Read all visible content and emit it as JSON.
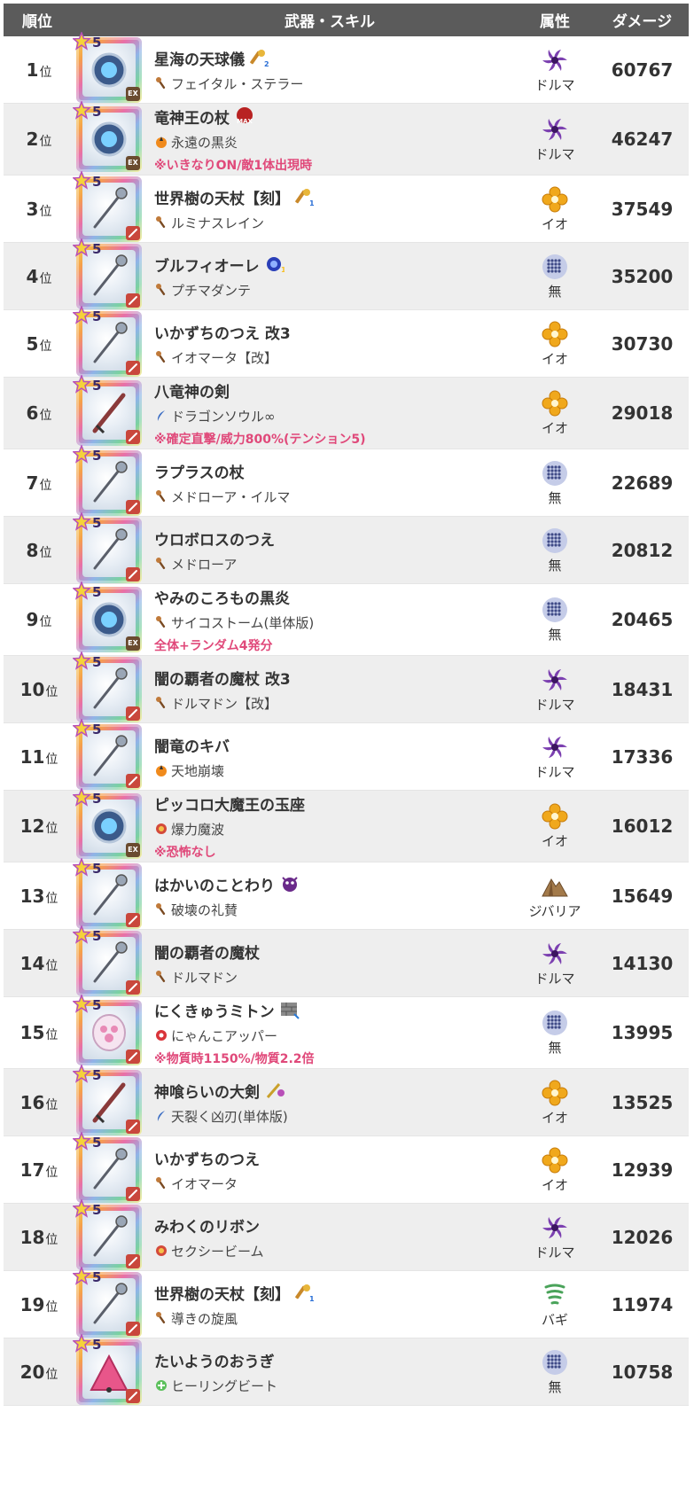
{
  "header": {
    "rank": "順位",
    "weapon_skill": "武器・スキル",
    "element": "属性",
    "damage": "ダメージ"
  },
  "rank_suffix": "位",
  "colors": {
    "header_bg": "#5b5b5b",
    "alt_row_bg": "#eeeeee",
    "note_pink": "#e0497a",
    "dolma_purple": "#7b3fb0",
    "io_orange": "#f0a81c"
  },
  "rows": [
    {
      "rank": "1",
      "weapon": "星海の天球儀",
      "badge": "weapon-level-2-icon",
      "skill": "フェイタル・ステラー",
      "skill_icon": "staff-skill-icon",
      "note": "",
      "element": "ドルマ",
      "damage": "60767",
      "corner": "EX"
    },
    {
      "rank": "2",
      "weapon": "竜神王の杖",
      "badge": "max-badge-icon",
      "skill": "永遠の黒炎",
      "skill_icon": "fire-skill-icon",
      "note": "※いきなりON/敵1体出現時",
      "element": "ドルマ",
      "damage": "46247",
      "corner": "EX"
    },
    {
      "rank": "3",
      "weapon": "世界樹の天杖【刻】",
      "badge": "weapon-level-1-icon",
      "skill": "ルミナスレイン",
      "skill_icon": "staff-skill-icon",
      "note": "",
      "element": "イオ",
      "damage": "37549",
      "corner": "staff"
    },
    {
      "rank": "4",
      "weapon": "ブルフィオーレ",
      "badge": "swirl-level-1-icon",
      "skill": "プチマダンテ",
      "skill_icon": "staff-skill-icon",
      "note": "",
      "element": "無",
      "damage": "35200",
      "corner": "whip"
    },
    {
      "rank": "5",
      "weapon": "いかずちのつえ 改3",
      "badge": "",
      "skill": "イオマータ【改】",
      "skill_icon": "staff-skill-icon",
      "note": "",
      "element": "イオ",
      "damage": "30730",
      "corner": "staff"
    },
    {
      "rank": "6",
      "weapon": "八竜神の剣",
      "badge": "",
      "skill": "ドラゴンソウル∞",
      "skill_icon": "slash-skill-icon",
      "note": "※確定直撃/威力800%(テンション5)",
      "element": "イオ",
      "damage": "29018",
      "corner": "sword"
    },
    {
      "rank": "7",
      "weapon": "ラプラスの杖",
      "badge": "",
      "skill": "メドローア・イルマ",
      "skill_icon": "staff-skill-icon",
      "note": "",
      "element": "無",
      "damage": "22689",
      "corner": "staff"
    },
    {
      "rank": "8",
      "weapon": "ウロボロスのつえ",
      "badge": "",
      "skill": "メドローア",
      "skill_icon": "staff-skill-icon",
      "note": "",
      "element": "無",
      "damage": "20812",
      "corner": "staff"
    },
    {
      "rank": "9",
      "weapon": "やみのころもの黒炎",
      "badge": "",
      "skill": "サイコストーム(単体版)",
      "skill_icon": "staff-skill-icon",
      "note": "全体+ランダム4発分",
      "element": "無",
      "damage": "20465",
      "corner": "EX"
    },
    {
      "rank": "10",
      "weapon": "闇の覇者の魔杖 改3",
      "badge": "",
      "skill": "ドルマドン【改】",
      "skill_icon": "staff-skill-icon",
      "note": "",
      "element": "ドルマ",
      "damage": "18431",
      "corner": "staff"
    },
    {
      "rank": "11",
      "weapon": "闇竜のキバ",
      "badge": "",
      "skill": "天地崩壊",
      "skill_icon": "fire-skill-icon",
      "note": "",
      "element": "ドルマ",
      "damage": "17336",
      "corner": "staff"
    },
    {
      "rank": "12",
      "weapon": "ピッコロ大魔王の玉座",
      "badge": "",
      "skill": "爆力魔波",
      "skill_icon": "burst-skill-icon",
      "note": "※恐怖なし",
      "element": "イオ",
      "damage": "16012",
      "corner": "EX"
    },
    {
      "rank": "13",
      "weapon": "はかいのことわり",
      "badge": "demon-face-icon",
      "skill": "破壊の礼賛",
      "skill_icon": "staff-skill-icon",
      "note": "",
      "element": "ジバリア",
      "damage": "15649",
      "corner": "staff"
    },
    {
      "rank": "14",
      "weapon": "闇の覇者の魔杖",
      "badge": "",
      "skill": "ドルマドン",
      "skill_icon": "staff-skill-icon",
      "note": "",
      "element": "ドルマ",
      "damage": "14130",
      "corner": "staff"
    },
    {
      "rank": "15",
      "weapon": "にくきゅうミトン",
      "badge": "brick-wall-icon",
      "skill": "にゃんこアッパー",
      "skill_icon": "gear-skill-icon",
      "note": "※物質時1150%/物質2.2倍",
      "element": "無",
      "damage": "13995",
      "corner": "claw"
    },
    {
      "rank": "16",
      "weapon": "神喰らいの大剣",
      "badge": "sword-pair-icon",
      "skill": "天裂く凶刃(単体版)",
      "skill_icon": "slash-skill-icon",
      "note": "",
      "element": "イオ",
      "damage": "13525",
      "corner": "sword"
    },
    {
      "rank": "17",
      "weapon": "いかずちのつえ",
      "badge": "",
      "skill": "イオマータ",
      "skill_icon": "staff-skill-icon",
      "note": "",
      "element": "イオ",
      "damage": "12939",
      "corner": "staff"
    },
    {
      "rank": "18",
      "weapon": "みわくのリボン",
      "badge": "",
      "skill": "セクシービーム",
      "skill_icon": "burst-skill-icon",
      "note": "",
      "element": "ドルマ",
      "damage": "12026",
      "corner": "whip"
    },
    {
      "rank": "19",
      "weapon": "世界樹の天杖【刻】",
      "badge": "weapon-level-1-icon",
      "skill": "導きの旋風",
      "skill_icon": "staff-skill-icon",
      "note": "",
      "element": "バギ",
      "damage": "11974",
      "corner": "staff"
    },
    {
      "rank": "20",
      "weapon": "たいようのおうぎ",
      "badge": "",
      "skill": "ヒーリングビート",
      "skill_icon": "heal-skill-icon",
      "note": "",
      "element": "無",
      "damage": "10758",
      "corner": "fan"
    }
  ]
}
